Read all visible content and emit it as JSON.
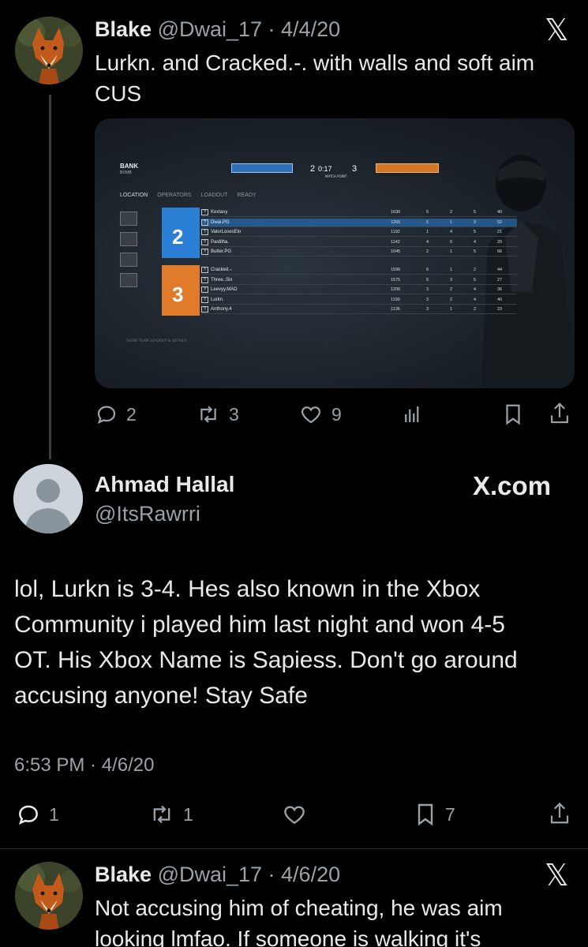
{
  "tweet1": {
    "name": "Blake",
    "meta": "@Dwai_17 · 4/4/20",
    "text_line1": "Lurkn. and Cracked.-. with walls and soft aim",
    "text_line2": "CUS",
    "x_glyph": "𝕏",
    "actions": {
      "replies": "2",
      "retweets": "3",
      "likes": "9"
    }
  },
  "scoreboard": {
    "map": "BANK",
    "mode": "BOMB",
    "timer": "0:17",
    "score_left": "2",
    "score_right": "3",
    "match_point": "MATCH POINT",
    "tabs": [
      "LOCATION",
      "OPERATORS",
      "LOADOUT",
      "READY"
    ],
    "footer": "SHOW TEAM LOADOUT & DETAILS",
    "team_blue_score": "2",
    "team_orange_score": "3",
    "blue_players": [
      {
        "name": "Kextasy",
        "score": "1630",
        "k": "5",
        "a": "2",
        "d": "5",
        "p": "40"
      },
      {
        "name": "Dwai.PG",
        "score": "1265",
        "k": "5",
        "a": "1",
        "d": "3",
        "p": "52"
      },
      {
        "name": "ValorLosesElo",
        "score": "1192",
        "k": "1",
        "a": "4",
        "d": "5",
        "p": "21"
      },
      {
        "name": "Pastilha.",
        "score": "1142",
        "k": "4",
        "a": "0",
        "d": "4",
        "p": "20"
      },
      {
        "name": "Butter.PG",
        "score": "1045",
        "k": "2",
        "a": "1",
        "d": "5",
        "p": "66"
      }
    ],
    "orange_players": [
      {
        "name": "Cracked.-.",
        "score": "1596",
        "k": "6",
        "a": "1",
        "d": "2",
        "p": "44"
      },
      {
        "name": "Three..Six",
        "score": "1575",
        "k": "5",
        "a": "3",
        "d": "5",
        "p": "27"
      },
      {
        "name": "Leevyy.MAD",
        "score": "1206",
        "k": "3",
        "a": "2",
        "d": "4",
        "p": "36"
      },
      {
        "name": "Lurkn.",
        "score": "1190",
        "k": "3",
        "a": "2",
        "d": "4",
        "p": "40"
      },
      {
        "name": "Anthony.4",
        "score": "1136",
        "k": "3",
        "a": "1",
        "d": "2",
        "p": "23"
      }
    ]
  },
  "reply": {
    "name": "Ahmad Hallal",
    "handle": "@ItsRawrri",
    "brand": "X.com",
    "line1": "lol, Lurkn is 3-4. Hes also known in the Xbox",
    "line2": "Community i played him last night and won 4-5",
    "line3": "OT. His Xbox Name is Sapiess. Don't go around",
    "line4": "accusing anyone! Stay Safe",
    "time": "6:53 PM · 4/6/20",
    "actions": {
      "replies": "1",
      "retweets": "1",
      "bookmarks": "7"
    }
  },
  "tweet3": {
    "name": "Blake",
    "meta": "@Dwai_17 · 4/6/20",
    "text_line1": "Not accusing him of cheating, he was aim",
    "text_line2": "looking lmfao. If someone is walking it's",
    "x_glyph": "𝕏"
  },
  "colors": {
    "background": "#000000",
    "text": "#e7e9ea",
    "muted": "#9aa1a7",
    "blue_team": "#2a7fd4",
    "orange_team": "#e07b2c"
  }
}
